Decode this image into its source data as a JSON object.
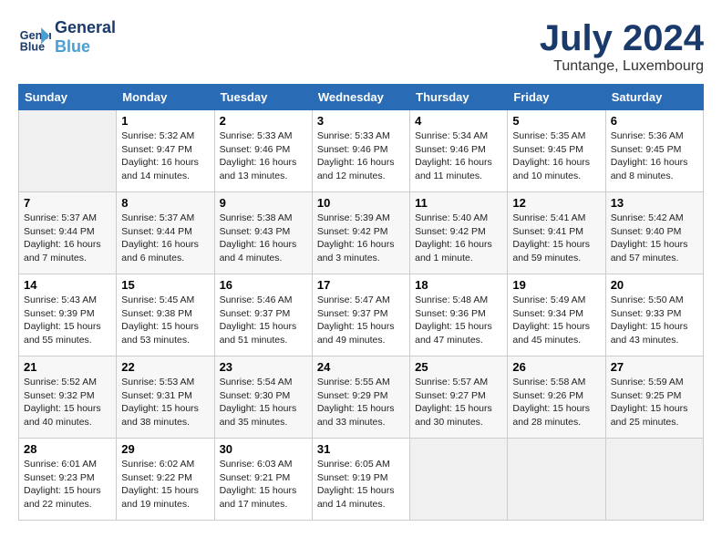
{
  "header": {
    "logo_line1": "General",
    "logo_line2": "Blue",
    "month": "July 2024",
    "location": "Tuntange, Luxembourg"
  },
  "days_of_week": [
    "Sunday",
    "Monday",
    "Tuesday",
    "Wednesday",
    "Thursday",
    "Friday",
    "Saturday"
  ],
  "weeks": [
    [
      {
        "day": "",
        "empty": true
      },
      {
        "day": "1",
        "sunrise": "Sunrise: 5:32 AM",
        "sunset": "Sunset: 9:47 PM",
        "daylight": "Daylight: 16 hours and 14 minutes."
      },
      {
        "day": "2",
        "sunrise": "Sunrise: 5:33 AM",
        "sunset": "Sunset: 9:46 PM",
        "daylight": "Daylight: 16 hours and 13 minutes."
      },
      {
        "day": "3",
        "sunrise": "Sunrise: 5:33 AM",
        "sunset": "Sunset: 9:46 PM",
        "daylight": "Daylight: 16 hours and 12 minutes."
      },
      {
        "day": "4",
        "sunrise": "Sunrise: 5:34 AM",
        "sunset": "Sunset: 9:46 PM",
        "daylight": "Daylight: 16 hours and 11 minutes."
      },
      {
        "day": "5",
        "sunrise": "Sunrise: 5:35 AM",
        "sunset": "Sunset: 9:45 PM",
        "daylight": "Daylight: 16 hours and 10 minutes."
      },
      {
        "day": "6",
        "sunrise": "Sunrise: 5:36 AM",
        "sunset": "Sunset: 9:45 PM",
        "daylight": "Daylight: 16 hours and 8 minutes."
      }
    ],
    [
      {
        "day": "7",
        "sunrise": "Sunrise: 5:37 AM",
        "sunset": "Sunset: 9:44 PM",
        "daylight": "Daylight: 16 hours and 7 minutes."
      },
      {
        "day": "8",
        "sunrise": "Sunrise: 5:37 AM",
        "sunset": "Sunset: 9:44 PM",
        "daylight": "Daylight: 16 hours and 6 minutes."
      },
      {
        "day": "9",
        "sunrise": "Sunrise: 5:38 AM",
        "sunset": "Sunset: 9:43 PM",
        "daylight": "Daylight: 16 hours and 4 minutes."
      },
      {
        "day": "10",
        "sunrise": "Sunrise: 5:39 AM",
        "sunset": "Sunset: 9:42 PM",
        "daylight": "Daylight: 16 hours and 3 minutes."
      },
      {
        "day": "11",
        "sunrise": "Sunrise: 5:40 AM",
        "sunset": "Sunset: 9:42 PM",
        "daylight": "Daylight: 16 hours and 1 minute."
      },
      {
        "day": "12",
        "sunrise": "Sunrise: 5:41 AM",
        "sunset": "Sunset: 9:41 PM",
        "daylight": "Daylight: 15 hours and 59 minutes."
      },
      {
        "day": "13",
        "sunrise": "Sunrise: 5:42 AM",
        "sunset": "Sunset: 9:40 PM",
        "daylight": "Daylight: 15 hours and 57 minutes."
      }
    ],
    [
      {
        "day": "14",
        "sunrise": "Sunrise: 5:43 AM",
        "sunset": "Sunset: 9:39 PM",
        "daylight": "Daylight: 15 hours and 55 minutes."
      },
      {
        "day": "15",
        "sunrise": "Sunrise: 5:45 AM",
        "sunset": "Sunset: 9:38 PM",
        "daylight": "Daylight: 15 hours and 53 minutes."
      },
      {
        "day": "16",
        "sunrise": "Sunrise: 5:46 AM",
        "sunset": "Sunset: 9:37 PM",
        "daylight": "Daylight: 15 hours and 51 minutes."
      },
      {
        "day": "17",
        "sunrise": "Sunrise: 5:47 AM",
        "sunset": "Sunset: 9:37 PM",
        "daylight": "Daylight: 15 hours and 49 minutes."
      },
      {
        "day": "18",
        "sunrise": "Sunrise: 5:48 AM",
        "sunset": "Sunset: 9:36 PM",
        "daylight": "Daylight: 15 hours and 47 minutes."
      },
      {
        "day": "19",
        "sunrise": "Sunrise: 5:49 AM",
        "sunset": "Sunset: 9:34 PM",
        "daylight": "Daylight: 15 hours and 45 minutes."
      },
      {
        "day": "20",
        "sunrise": "Sunrise: 5:50 AM",
        "sunset": "Sunset: 9:33 PM",
        "daylight": "Daylight: 15 hours and 43 minutes."
      }
    ],
    [
      {
        "day": "21",
        "sunrise": "Sunrise: 5:52 AM",
        "sunset": "Sunset: 9:32 PM",
        "daylight": "Daylight: 15 hours and 40 minutes."
      },
      {
        "day": "22",
        "sunrise": "Sunrise: 5:53 AM",
        "sunset": "Sunset: 9:31 PM",
        "daylight": "Daylight: 15 hours and 38 minutes."
      },
      {
        "day": "23",
        "sunrise": "Sunrise: 5:54 AM",
        "sunset": "Sunset: 9:30 PM",
        "daylight": "Daylight: 15 hours and 35 minutes."
      },
      {
        "day": "24",
        "sunrise": "Sunrise: 5:55 AM",
        "sunset": "Sunset: 9:29 PM",
        "daylight": "Daylight: 15 hours and 33 minutes."
      },
      {
        "day": "25",
        "sunrise": "Sunrise: 5:57 AM",
        "sunset": "Sunset: 9:27 PM",
        "daylight": "Daylight: 15 hours and 30 minutes."
      },
      {
        "day": "26",
        "sunrise": "Sunrise: 5:58 AM",
        "sunset": "Sunset: 9:26 PM",
        "daylight": "Daylight: 15 hours and 28 minutes."
      },
      {
        "day": "27",
        "sunrise": "Sunrise: 5:59 AM",
        "sunset": "Sunset: 9:25 PM",
        "daylight": "Daylight: 15 hours and 25 minutes."
      }
    ],
    [
      {
        "day": "28",
        "sunrise": "Sunrise: 6:01 AM",
        "sunset": "Sunset: 9:23 PM",
        "daylight": "Daylight: 15 hours and 22 minutes."
      },
      {
        "day": "29",
        "sunrise": "Sunrise: 6:02 AM",
        "sunset": "Sunset: 9:22 PM",
        "daylight": "Daylight: 15 hours and 19 minutes."
      },
      {
        "day": "30",
        "sunrise": "Sunrise: 6:03 AM",
        "sunset": "Sunset: 9:21 PM",
        "daylight": "Daylight: 15 hours and 17 minutes."
      },
      {
        "day": "31",
        "sunrise": "Sunrise: 6:05 AM",
        "sunset": "Sunset: 9:19 PM",
        "daylight": "Daylight: 15 hours and 14 minutes."
      },
      {
        "day": "",
        "empty": true
      },
      {
        "day": "",
        "empty": true
      },
      {
        "day": "",
        "empty": true
      }
    ]
  ]
}
